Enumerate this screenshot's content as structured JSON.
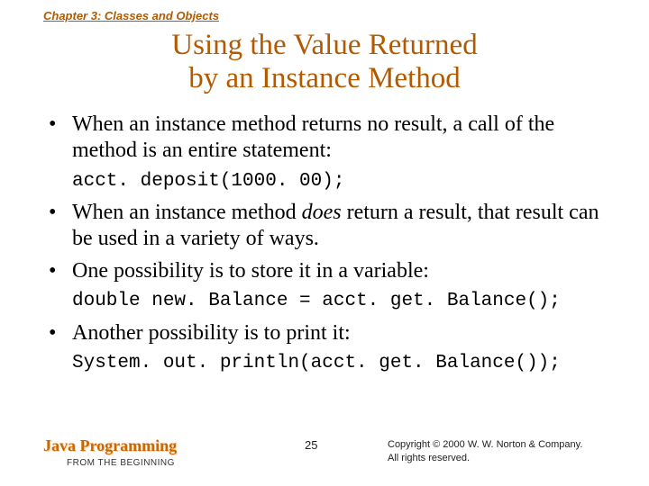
{
  "chapter": "Chapter 3: Classes and Objects",
  "title_line1": "Using the Value Returned",
  "title_line2": "by an Instance Method",
  "bullets": {
    "b1": "When an instance method returns no result, a call of the method is an entire statement:",
    "code1": "acct. deposit(1000. 00);",
    "b2a": "When an instance method ",
    "b2b": "does",
    "b2c": " return a result, that result can be used in a variety of ways.",
    "b3": "One possibility is to store it in a variable:",
    "code2": "double new. Balance = acct. get. Balance();",
    "b4": "Another possibility is to print it:",
    "code3": "System. out. println(acct. get. Balance());"
  },
  "footer": {
    "book_title": "Java Programming",
    "book_sub": "FROM THE BEGINNING",
    "page": "25",
    "copy1": "Copyright © 2000 W. W. Norton & Company.",
    "copy2": "All rights reserved."
  }
}
